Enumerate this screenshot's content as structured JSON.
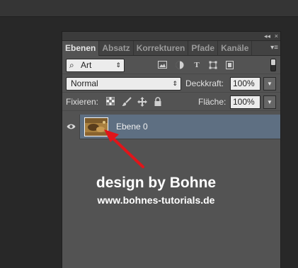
{
  "panel": {
    "controls": {
      "collapse": "◂◂",
      "close": "×"
    },
    "tabs": [
      {
        "label": "Ebenen",
        "active": true
      },
      {
        "label": "Absatz",
        "active": false
      },
      {
        "label": "Korrekturen",
        "active": false
      },
      {
        "label": "Pfade",
        "active": false
      },
      {
        "label": "Kanäle",
        "active": false
      }
    ],
    "menu_glyph": "▾≡"
  },
  "filter": {
    "kind_value": "Art",
    "icons": [
      "image-icon",
      "adjustment-icon",
      "type-icon",
      "shape-icon",
      "smart-object-icon"
    ]
  },
  "blend": {
    "mode": "Normal",
    "opacity_label": "Deckkraft:",
    "opacity_value": "100%"
  },
  "lock": {
    "label": "Fixieren:",
    "fill_label": "Fläche:",
    "fill_value": "100%"
  },
  "layers": [
    {
      "name": "Ebene 0",
      "visible": true,
      "selected": true
    }
  ],
  "watermark": {
    "line1": "design by Bohne",
    "line2": "www.bohnes-tutorials.de"
  },
  "colors": {
    "selected_row": "#5e6f82",
    "panel_bg": "#535353",
    "arrow": "#e0151a"
  }
}
